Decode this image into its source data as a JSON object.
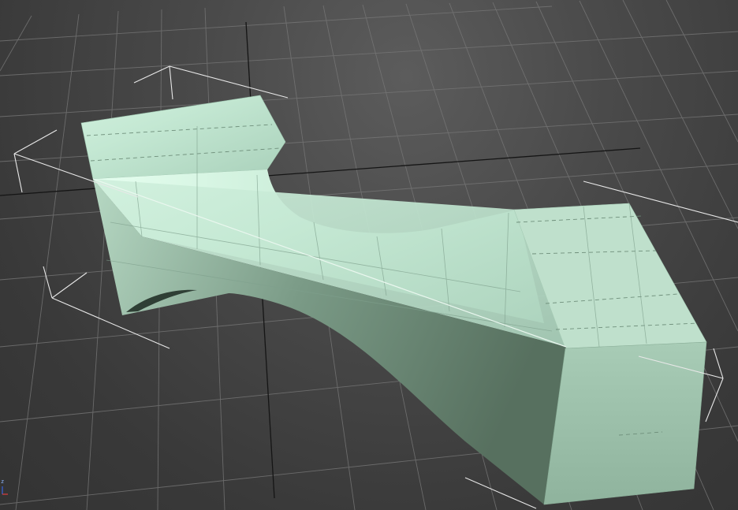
{
  "viewport": {
    "axis_tripod": {
      "z_label": "z"
    }
  },
  "colors": {
    "background": "#3e3e3e",
    "grid_line": "#7a7a7a",
    "home_grid_axis": "#151515",
    "object_face_light": "#bfe3cf",
    "object_face_dark": "#58705f",
    "selection_bracket": "#e8e8e8"
  },
  "icons": {
    "viewcube": "axis-tripod-icon"
  }
}
